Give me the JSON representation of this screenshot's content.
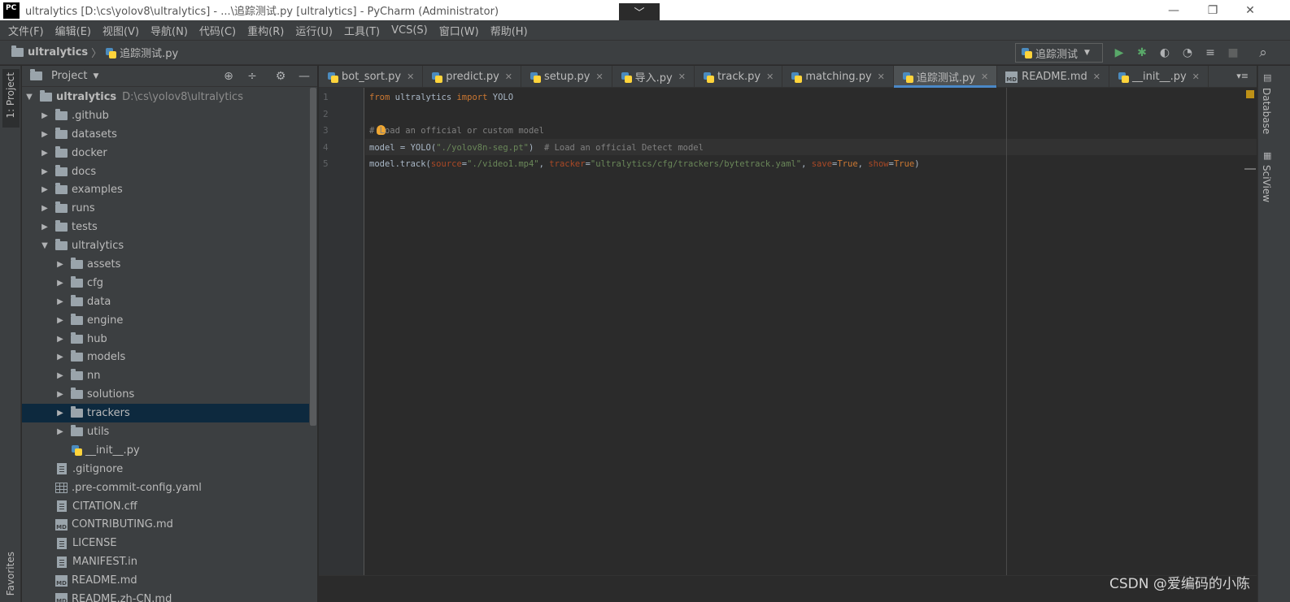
{
  "window": {
    "logo_text": "PC",
    "title": "ultralytics [D:\\cs\\yolov8\\ultralytics] - ...\\追踪测试.py [ultralytics] - PyCharm (Administrator)",
    "center_glyph": "﹀",
    "controls": {
      "minimize": "—",
      "restore": "❐",
      "close": "✕"
    }
  },
  "menu": [
    "文件(F)",
    "编辑(E)",
    "视图(V)",
    "导航(N)",
    "代码(C)",
    "重构(R)",
    "运行(U)",
    "工具(T)",
    "VCS(S)",
    "窗口(W)",
    "帮助(H)"
  ],
  "navbar": {
    "project": "ultralytics",
    "separator": "〉",
    "file": "追踪测试.py",
    "run_config": "追踪测试",
    "run_config_arrow": "▼",
    "tools": {
      "run": "▶",
      "debug": "✱",
      "coverage": "◐",
      "profile": "◔",
      "build": "≡",
      "stop": "■",
      "search": "⌕"
    }
  },
  "left_stripe": {
    "project_tab": "1: Project",
    "favorites_tab": "Favorites"
  },
  "project_panel": {
    "header": "Project",
    "header_arrow": "▼",
    "tools": {
      "locate": "⊕",
      "collapse": "÷",
      "settings": "⚙",
      "hide": "—"
    },
    "tree": [
      {
        "label": "ultralytics",
        "hint": "D:\\cs\\yolov8\\ultralytics",
        "type": "folder",
        "depth": 0,
        "expanded": true,
        "bold": true
      },
      {
        "label": ".github",
        "type": "folder",
        "depth": 1,
        "expanded": false
      },
      {
        "label": "datasets",
        "type": "folder",
        "depth": 1,
        "expanded": false
      },
      {
        "label": "docker",
        "type": "folder",
        "depth": 1,
        "expanded": false
      },
      {
        "label": "docs",
        "type": "folder",
        "depth": 1,
        "expanded": false
      },
      {
        "label": "examples",
        "type": "folder",
        "depth": 1,
        "expanded": false
      },
      {
        "label": "runs",
        "type": "folder",
        "depth": 1,
        "expanded": false
      },
      {
        "label": "tests",
        "type": "folder",
        "depth": 1,
        "expanded": false
      },
      {
        "label": "ultralytics",
        "type": "folder",
        "depth": 1,
        "expanded": true
      },
      {
        "label": "assets",
        "type": "folder",
        "depth": 2,
        "expanded": false
      },
      {
        "label": "cfg",
        "type": "folder",
        "depth": 2,
        "expanded": false
      },
      {
        "label": "data",
        "type": "folder",
        "depth": 2,
        "expanded": false
      },
      {
        "label": "engine",
        "type": "folder",
        "depth": 2,
        "expanded": false
      },
      {
        "label": "hub",
        "type": "folder",
        "depth": 2,
        "expanded": false
      },
      {
        "label": "models",
        "type": "folder",
        "depth": 2,
        "expanded": false
      },
      {
        "label": "nn",
        "type": "folder",
        "depth": 2,
        "expanded": false
      },
      {
        "label": "solutions",
        "type": "folder",
        "depth": 2,
        "expanded": false
      },
      {
        "label": "trackers",
        "type": "folder",
        "depth": 2,
        "expanded": false,
        "selected": true
      },
      {
        "label": "utils",
        "type": "folder",
        "depth": 2,
        "expanded": false
      },
      {
        "label": "__init__.py",
        "type": "py",
        "depth": 2
      },
      {
        "label": ".gitignore",
        "type": "file",
        "depth": 1
      },
      {
        "label": ".pre-commit-config.yaml",
        "type": "table",
        "depth": 1
      },
      {
        "label": "CITATION.cff",
        "type": "file",
        "depth": 1
      },
      {
        "label": "CONTRIBUTING.md",
        "type": "md",
        "depth": 1
      },
      {
        "label": "LICENSE",
        "type": "file",
        "depth": 1
      },
      {
        "label": "MANIFEST.in",
        "type": "file",
        "depth": 1
      },
      {
        "label": "README.md",
        "type": "md",
        "depth": 1
      },
      {
        "label": "README.zh-CN.md",
        "type": "md",
        "depth": 1
      }
    ]
  },
  "editor_tabs": [
    {
      "label": "bot_sort.py",
      "icon": "py",
      "active": false
    },
    {
      "label": "predict.py",
      "icon": "py",
      "active": false
    },
    {
      "label": "setup.py",
      "icon": "py",
      "active": false
    },
    {
      "label": "导入.py",
      "icon": "py",
      "active": false
    },
    {
      "label": "track.py",
      "icon": "py",
      "active": false
    },
    {
      "label": "matching.py",
      "icon": "py",
      "active": false
    },
    {
      "label": "追踪测试.py",
      "icon": "py",
      "active": true
    },
    {
      "label": "README.md",
      "icon": "md",
      "active": false
    },
    {
      "label": "__init__.py",
      "icon": "py",
      "active": false
    }
  ],
  "tab_close": "✕",
  "tabs_menu": "▾≡",
  "editor": {
    "line_numbers": [
      "1",
      "2",
      "3",
      "4",
      "5"
    ],
    "lines": [
      [
        {
          "t": "from",
          "c": "kw"
        },
        {
          "t": " ultralytics ",
          "c": ""
        },
        {
          "t": "import",
          "c": "kw"
        },
        {
          "t": " YOLO",
          "c": ""
        }
      ],
      [],
      [
        {
          "t": "# Load an official or custom model",
          "c": "cmt"
        }
      ],
      [
        {
          "t": "model = YOLO(",
          "c": ""
        },
        {
          "t": "\"./yolov8n-seg.pt\"",
          "c": "str"
        },
        {
          "t": ")  ",
          "c": ""
        },
        {
          "t": "# Load an official Detect model",
          "c": "cmt"
        }
      ],
      [
        {
          "t": "model.track(",
          "c": ""
        },
        {
          "t": "source",
          "c": "param"
        },
        {
          "t": "=",
          "c": ""
        },
        {
          "t": "\"./video1.mp4\"",
          "c": "str"
        },
        {
          "t": ", ",
          "c": ""
        },
        {
          "t": "tracker",
          "c": "param"
        },
        {
          "t": "=",
          "c": ""
        },
        {
          "t": "\"ultralytics/cfg/trackers/bytetrack.yaml\"",
          "c": "str"
        },
        {
          "t": ", ",
          "c": ""
        },
        {
          "t": "save",
          "c": "param"
        },
        {
          "t": "=",
          "c": ""
        },
        {
          "t": "True",
          "c": "kw"
        },
        {
          "t": ", ",
          "c": ""
        },
        {
          "t": "show",
          "c": "param"
        },
        {
          "t": "=",
          "c": ""
        },
        {
          "t": "True",
          "c": "kw"
        },
        {
          "t": ")",
          "c": ""
        }
      ]
    ]
  },
  "right_stripe": {
    "database": "Database",
    "sciview": "SciView"
  },
  "watermark": "CSDN @爱编码的小陈",
  "colors": {
    "accent": "#4a88c7",
    "keyword": "#cc7832",
    "string": "#6a8759",
    "comment": "#808080",
    "selection": "#0d293e"
  }
}
